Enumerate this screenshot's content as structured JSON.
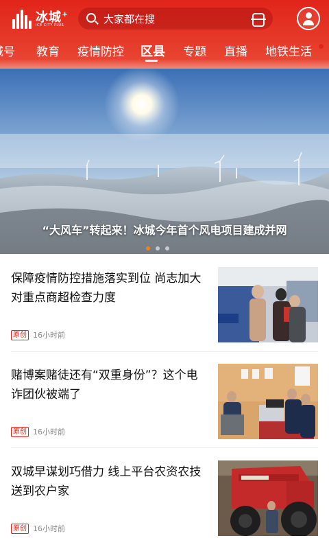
{
  "header": {
    "logo_name": "冰城",
    "logo_plus": "+",
    "logo_sub": "ICE CITY PLUS",
    "search_placeholder": "大家都在搜",
    "colors": {
      "brand": "#e1251b"
    }
  },
  "tabs": [
    "城号",
    "教育",
    "疫情防控",
    "区县",
    "专题",
    "直播",
    "地铁生活"
  ],
  "active_tab": "区县",
  "banner": {
    "caption": "“大风车”转起来！冰城今年首个风电项目建成并网",
    "slide_count": 3,
    "active_slide": 1
  },
  "articles": [
    {
      "title": "保障疫情防控措施落实到位 尚志加大对重点商超检查力度",
      "badge": "原创",
      "time": "16小时前"
    },
    {
      "title": "赌博案赌徒还有“双重身份”？这个电诈团伙被端了",
      "badge": "原创",
      "time": "16小时前"
    },
    {
      "title": "双城早谋划巧借力 线上平台农资农技送到农户家",
      "badge": "原创",
      "time": "16小时前"
    }
  ]
}
